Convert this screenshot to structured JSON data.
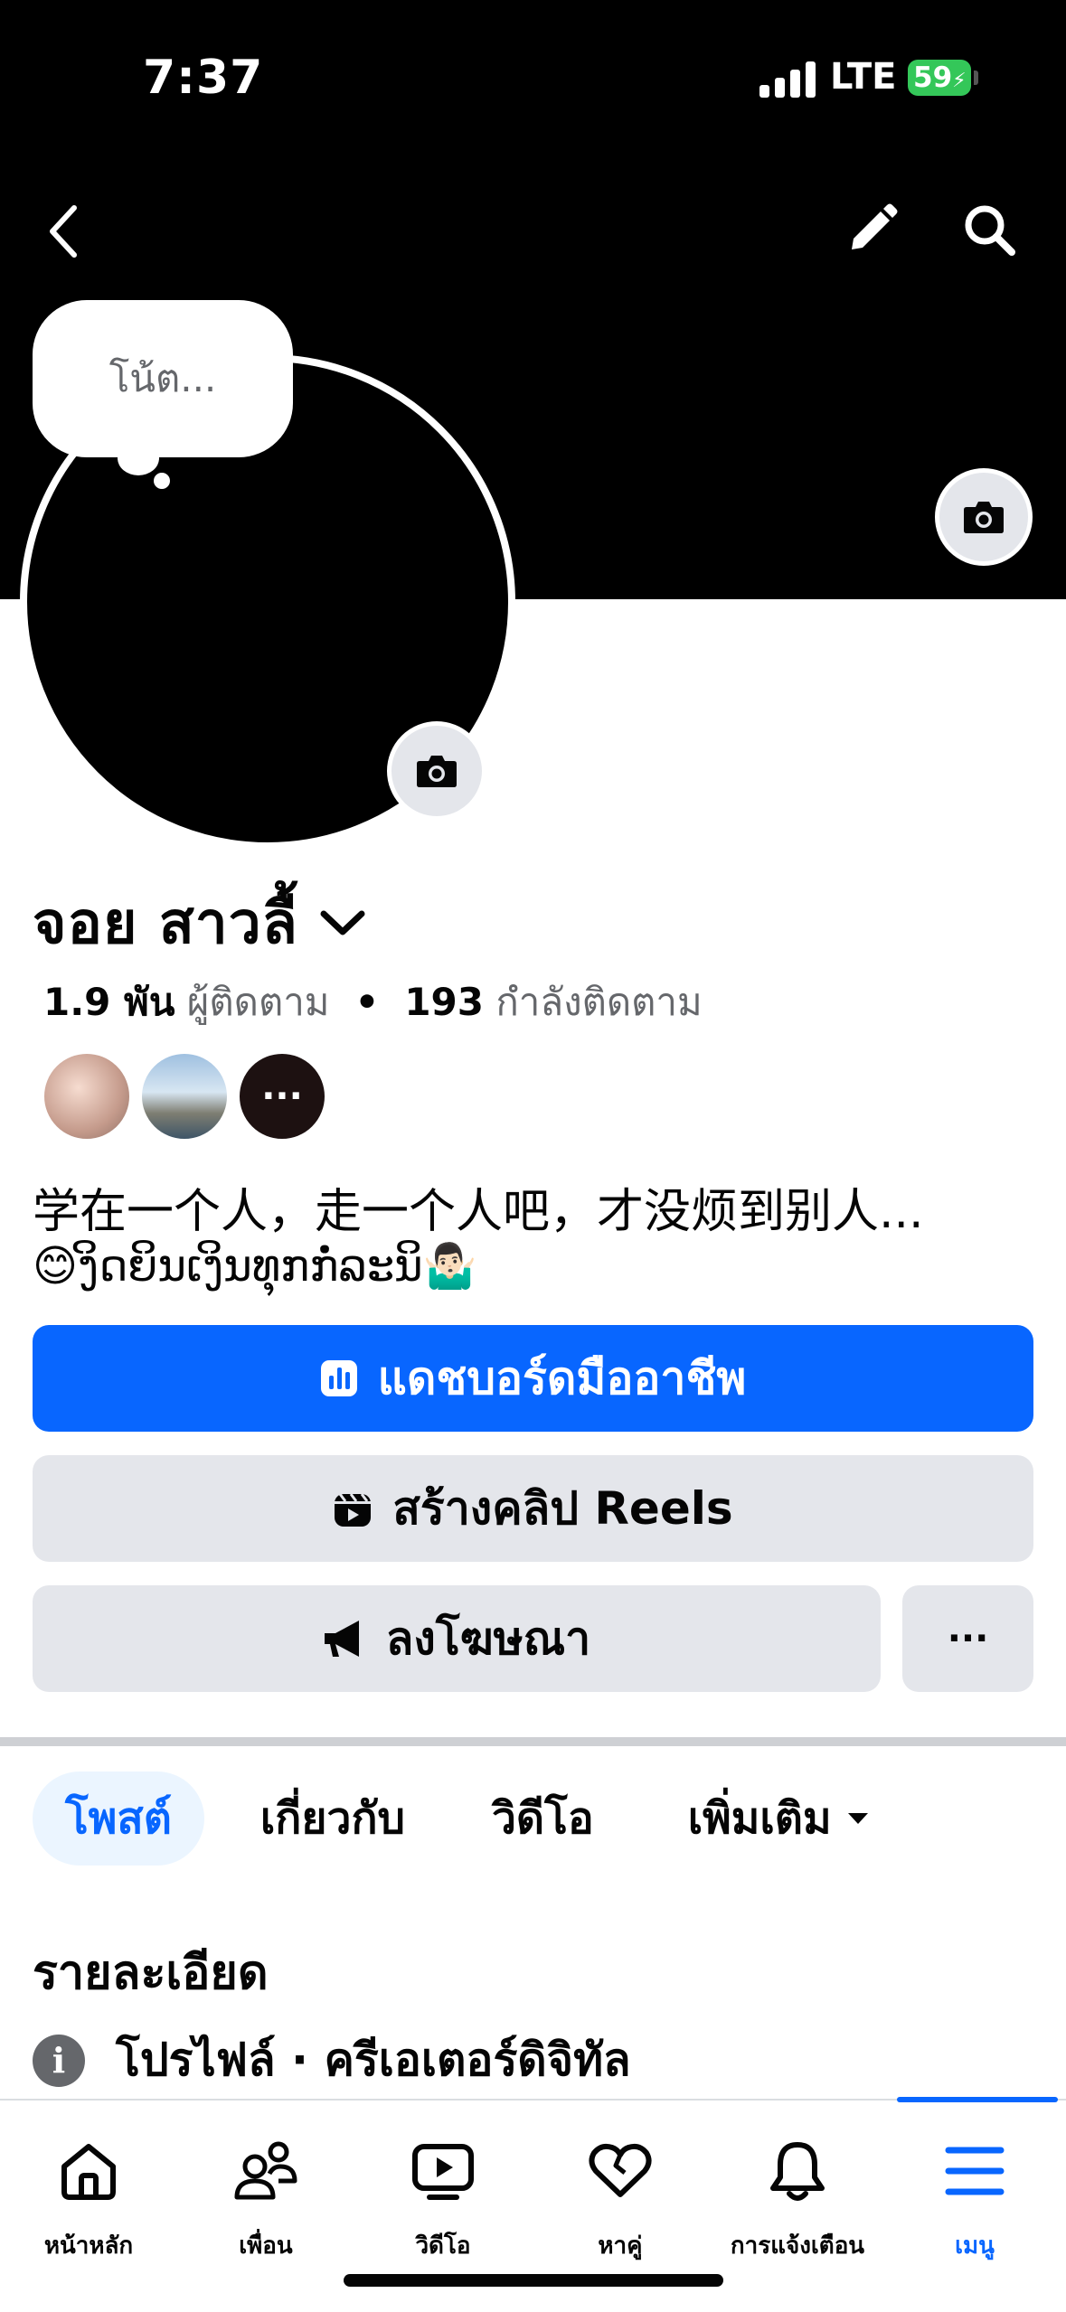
{
  "status_bar": {
    "time": "7:37",
    "network": "LTE",
    "battery": "59"
  },
  "header": {
    "back_icon": "chevron-left-icon",
    "edit_icon": "pencil-icon",
    "search_icon": "search-icon"
  },
  "cover": {
    "camera_icon": "camera-icon",
    "color": "#000000"
  },
  "profile": {
    "note_placeholder": "โน้ต...",
    "name": "จอย สาวลื้",
    "followers_count": "1.9 พัน",
    "followers_label": "ผู้ติดตาม",
    "following_count": "193",
    "following_label": "กำลังติดตาม",
    "friends_more": "···",
    "bio_line1": "学在一个人，走一个人吧，才没烦到别人...",
    "bio_line2": "😊ງິດຍິນເງິນທຸກກໍ່ລະນິ🤷🏻‍♂️"
  },
  "actions": {
    "dashboard_label": "แดชบอร์ดมืออาชีพ",
    "reels_label": "สร้างคลิป Reels",
    "ads_label": "ลงโฆษณา",
    "more_label": "···"
  },
  "tabs": [
    {
      "label": "โพสต์",
      "active": true
    },
    {
      "label": "เกี่ยวกับ"
    },
    {
      "label": "วิดีโอ"
    },
    {
      "label": "เพิ่มเติม"
    }
  ],
  "details": {
    "heading": "รายละเอียด",
    "info_icon_glyph": "i",
    "line": "โปรไฟล์ · ครีเอเตอร์ดิจิทัล"
  },
  "bottom_nav": [
    {
      "label": "หน้าหลัก",
      "icon": "home-icon"
    },
    {
      "label": "เพื่อน",
      "icon": "friends-icon"
    },
    {
      "label": "วิดีโอ",
      "icon": "video-icon"
    },
    {
      "label": "หาคู่",
      "icon": "dating-heart-icon"
    },
    {
      "label": "การแจ้งเตือน",
      "icon": "bell-icon"
    },
    {
      "label": "เมนู",
      "icon": "menu-icon",
      "active": true
    }
  ],
  "colors": {
    "accent": "#0866ff",
    "button_gray": "#e4e6eb",
    "secondary_text": "#65676b"
  }
}
